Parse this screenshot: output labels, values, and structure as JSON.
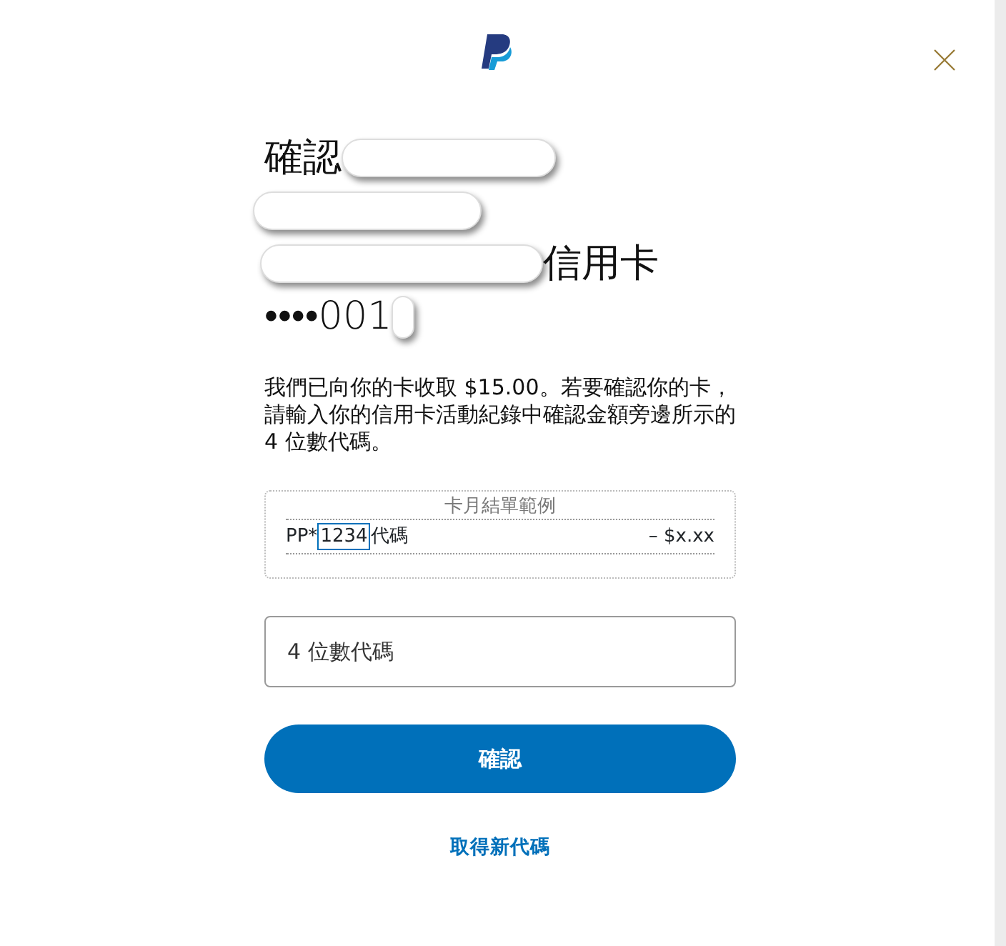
{
  "heading": {
    "lines": [
      [
        {
          "kind": "text",
          "text": "確認"
        },
        {
          "kind": "redaction"
        }
      ],
      [
        {
          "kind": "redaction"
        }
      ],
      [
        {
          "kind": "redaction"
        },
        {
          "kind": "text",
          "text": "信用卡"
        }
      ],
      [
        {
          "kind": "text",
          "text": "••••001"
        },
        {
          "kind": "redaction"
        }
      ]
    ]
  },
  "message": "我們已向你的卡收取 $15.00。若要確認你的卡，請輸入你的信用卡活動紀錄中確認金額旁邊所示的 4 位數代碼。",
  "statement_example": {
    "title": "卡月結單範例",
    "prefix": "PP*",
    "code": "1234",
    "suffix": "代碼",
    "amount": "– $x.xx"
  },
  "code_field": {
    "placeholder": "4 位數代碼"
  },
  "confirm_button": "確認",
  "new_code_link": "取得新代碼"
}
